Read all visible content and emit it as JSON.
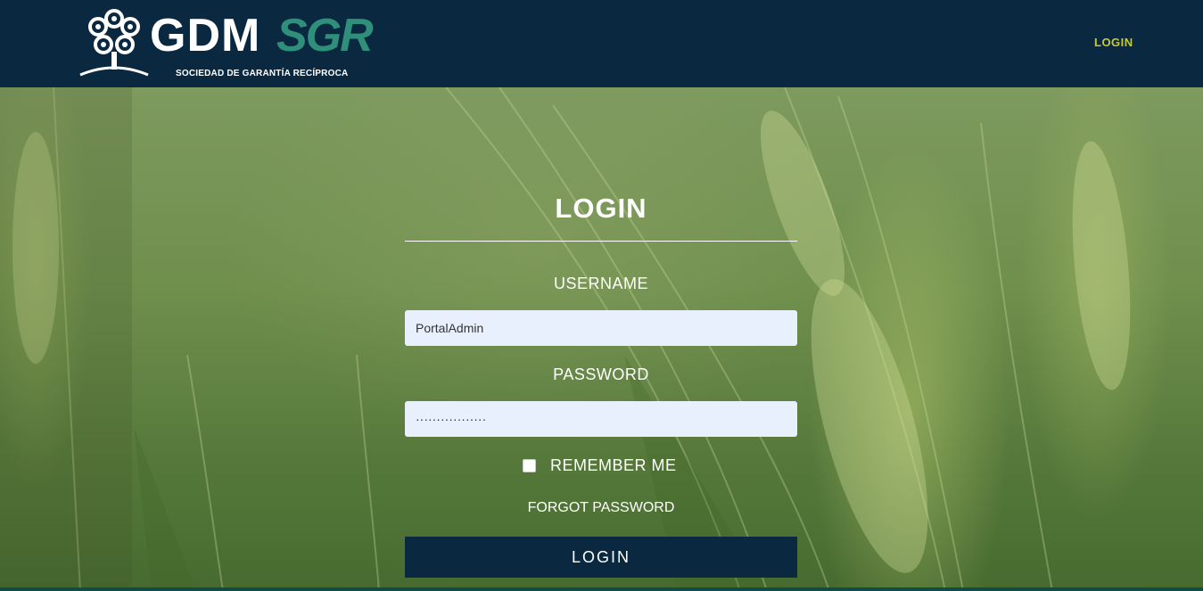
{
  "navbar": {
    "logo_main": "GDM",
    "logo_accent": "SGR",
    "logo_subtitle": "SOCIEDAD DE GARANTÍA RECÍPROCA",
    "login_link": "LOGIN"
  },
  "form": {
    "title": "LOGIN",
    "username_label": "USERNAME",
    "username_value": "PortalAdmin",
    "password_label": "PASSWORD",
    "password_value": "·················",
    "remember_label": "REMEMBER ME",
    "remember_checked": false,
    "forgot_label": "FORGOT PASSWORD",
    "submit_label": "LOGIN"
  },
  "colors": {
    "navbar_bg": "#0a2940",
    "accent_yellow": "#c6c932",
    "logo_green": "#2f8f7a",
    "input_bg": "#e8f0fe"
  },
  "icons": {
    "logo_mark": "tree-icon",
    "checkbox": "checkbox-unchecked"
  }
}
